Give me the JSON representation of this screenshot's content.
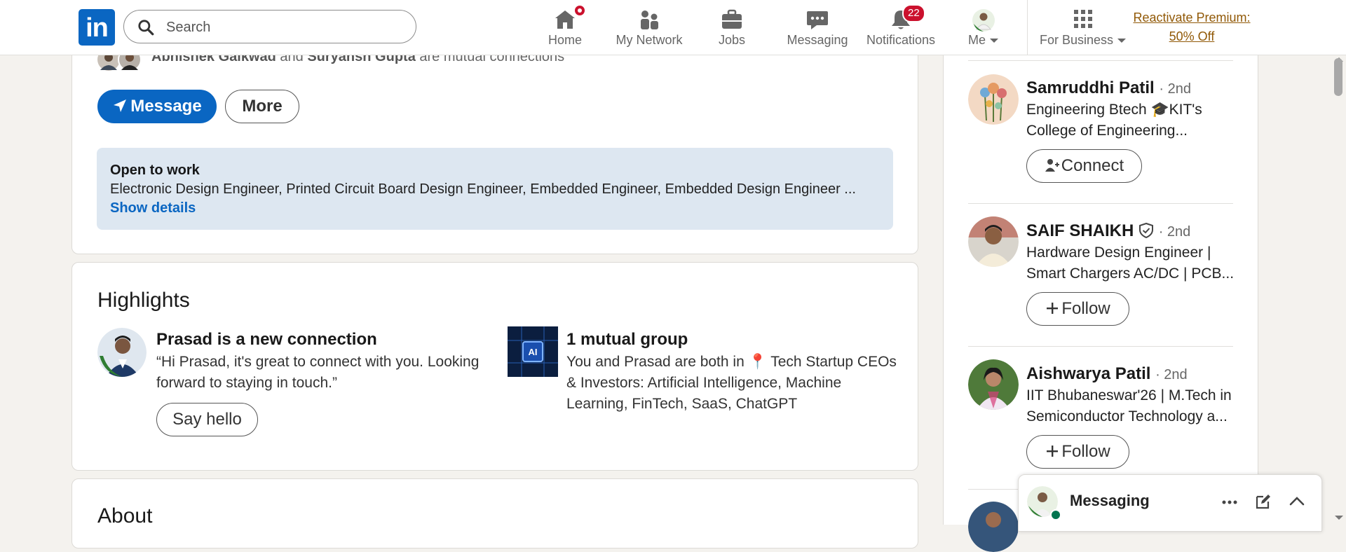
{
  "nav": {
    "logo_text": "in",
    "search_placeholder": "Search",
    "items": [
      {
        "label": "Home"
      },
      {
        "label": "My Network"
      },
      {
        "label": "Jobs"
      },
      {
        "label": "Messaging"
      },
      {
        "label": "Notifications",
        "badge": "22"
      },
      {
        "label": "Me"
      },
      {
        "label": "For Business"
      }
    ],
    "premium_line1": "Reactivate Premium:",
    "premium_line2": "50% Off"
  },
  "profile": {
    "mutual_name1": "Abhishek Gaikwad",
    "mutual_and": "and",
    "mutual_name2": "Suryansh Gupta",
    "mutual_suffix": "are mutual connections",
    "message_button": "Message",
    "more_button": "More",
    "open_to_work": {
      "title": "Open to work",
      "roles": "Electronic Design Engineer, Printed Circuit Board Design Engineer, Embedded Engineer, Embedded Design Engineer ...",
      "link": "Show details"
    }
  },
  "highlights": {
    "title": "Highlights",
    "connection": {
      "title": "Prasad is a new connection",
      "line1": "“Hi Prasad, it's great to connect with you. Looking",
      "line2": "forward to staying in touch.”",
      "button": "Say hello"
    },
    "group": {
      "title": "1 mutual group",
      "line1": "You and Prasad are both in 📍 Tech Startup CEOs",
      "line2": "& Investors: Artificial Intelligence, Machine",
      "line3": "Learning, FinTech, SaaS, ChatGPT",
      "logo_text": "AI"
    }
  },
  "about": {
    "title": "About"
  },
  "suggestions": [
    {
      "name": "Samruddhi Patil",
      "degree": "· 2nd",
      "line1": "Engineering Btech 🎓KIT's",
      "line2": "College of Engineering...",
      "action": "Connect"
    },
    {
      "name": "SAIF SHAIKH",
      "degree": "· 2nd",
      "line1": "Hardware Design Engineer |",
      "line2": "Smart Chargers AC/DC | PCB...",
      "action": "Follow"
    },
    {
      "name": "Aishwarya Patil",
      "degree": "· 2nd",
      "line1": "IIT Bhubaneswar'26 | M.Tech in",
      "line2": "Semiconductor Technology a...",
      "action": "Follow"
    }
  ],
  "messaging": {
    "title": "Messaging"
  },
  "colors": {
    "brand": "#0a66c2",
    "badge": "#cb112d",
    "premium": "#915907",
    "open_to_work_bg": "#dde7f1"
  }
}
